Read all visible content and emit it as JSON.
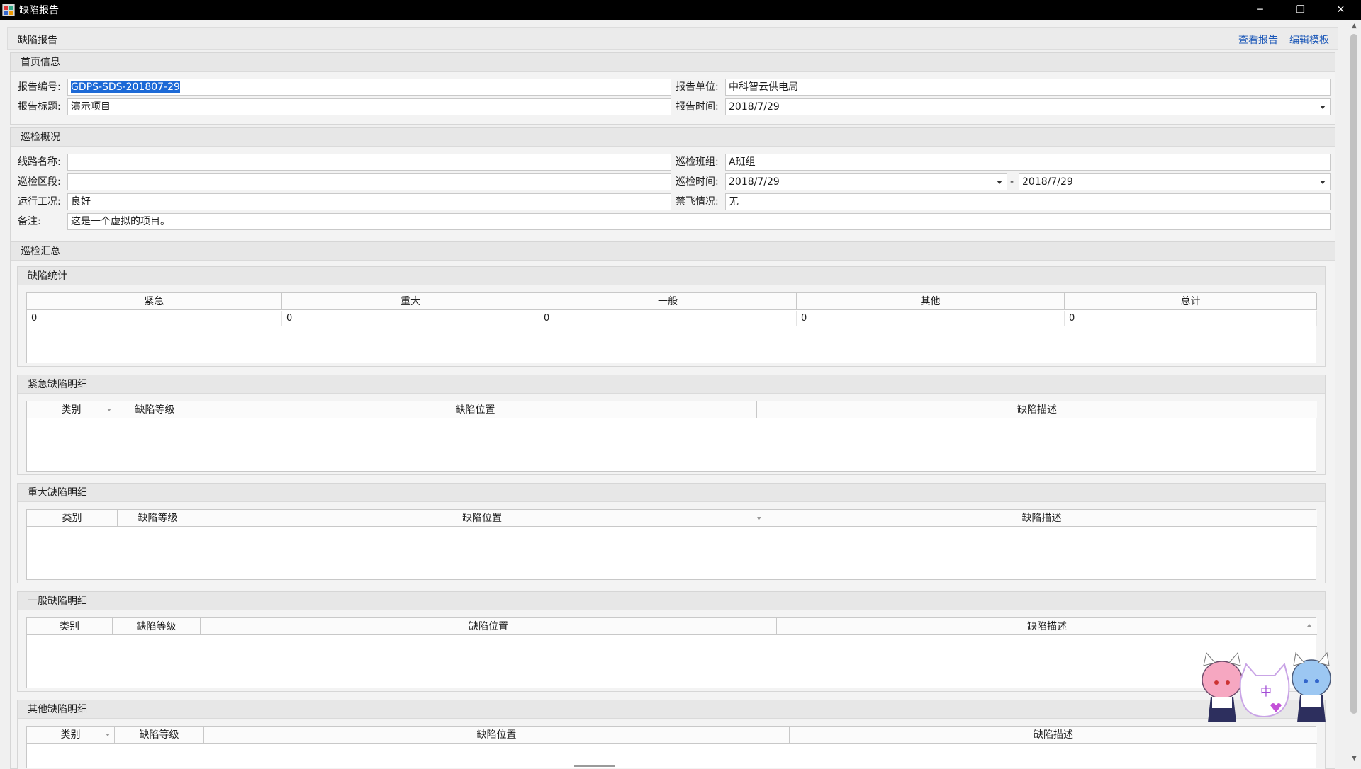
{
  "window": {
    "title": "缺陷报告",
    "buttons": {
      "minimize": "─",
      "restore": "❐",
      "close": "✕"
    }
  },
  "header": {
    "title": "缺陷报告",
    "view_report": "查看报告",
    "edit_template": "编辑模板"
  },
  "home_info": {
    "title": "首页信息",
    "report_no_label": "报告编号:",
    "report_no_value": "GDPS-SDS-201807-29",
    "report_unit_label": "报告单位:",
    "report_unit_value": "中科智云供电局",
    "report_title_label": "报告标题:",
    "report_title_value": "演示项目",
    "report_time_label": "报告时间:",
    "report_time_value": "2018/7/29"
  },
  "overview": {
    "title": "巡检概况",
    "line_name_label": "线路名称:",
    "line_name_value": "",
    "team_label": "巡检班组:",
    "team_value": "A班组",
    "section_label": "巡检区段:",
    "section_value": "",
    "time_label": "巡检时间:",
    "time_from": "2018/7/29",
    "time_sep": "-",
    "time_to": "2018/7/29",
    "condition_label": "运行工况:",
    "condition_value": "良好",
    "nofly_label": "禁飞情况:",
    "nofly_value": "无",
    "remark_label": "备注:",
    "remark_value": "这是一个虚拟的项目。"
  },
  "summary": {
    "title": "巡检汇总",
    "stats": {
      "title": "缺陷统计",
      "columns": [
        "紧急",
        "重大",
        "一般",
        "其他",
        "总计"
      ],
      "values": [
        "0",
        "0",
        "0",
        "0",
        "0"
      ]
    },
    "urgent": {
      "title": "紧急缺陷明细",
      "columns": [
        "类别",
        "缺陷等级",
        "缺陷位置",
        "缺陷描述"
      ]
    },
    "major": {
      "title": "重大缺陷明细",
      "columns": [
        "类别",
        "缺陷等级",
        "缺陷位置",
        "缺陷描述"
      ]
    },
    "general": {
      "title": "一般缺陷明细",
      "columns": [
        "类别",
        "缺陷等级",
        "缺陷位置",
        "缺陷描述"
      ]
    },
    "other": {
      "title": "其他缺陷明细",
      "columns": [
        "类别",
        "缺陷等级",
        "缺陷位置",
        "缺陷描述"
      ]
    }
  },
  "mascot": {
    "badge": "中"
  }
}
